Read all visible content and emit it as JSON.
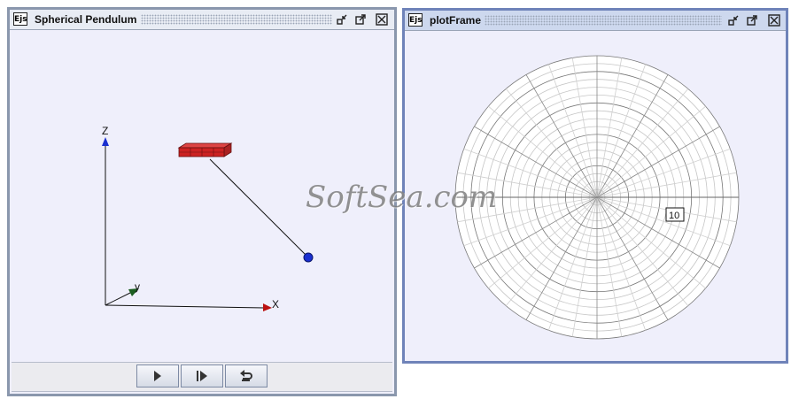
{
  "window_left": {
    "title": "Spherical Pendulum",
    "logo": "Ejs",
    "axes": {
      "x": "X",
      "y": "y",
      "z": "Z"
    },
    "controls": [
      {
        "name": "play-button",
        "icon": "play-icon"
      },
      {
        "name": "step-button",
        "icon": "step-icon"
      },
      {
        "name": "reset-button",
        "icon": "reset-icon"
      }
    ]
  },
  "window_right": {
    "title": "plotFrame",
    "logo": "Ejs",
    "radius_label": "10"
  },
  "watermark": "SoftSea.com",
  "colors": {
    "bob": "#1a2fd0",
    "support": "#cc2222",
    "frame_accent": "#6f83b9"
  }
}
